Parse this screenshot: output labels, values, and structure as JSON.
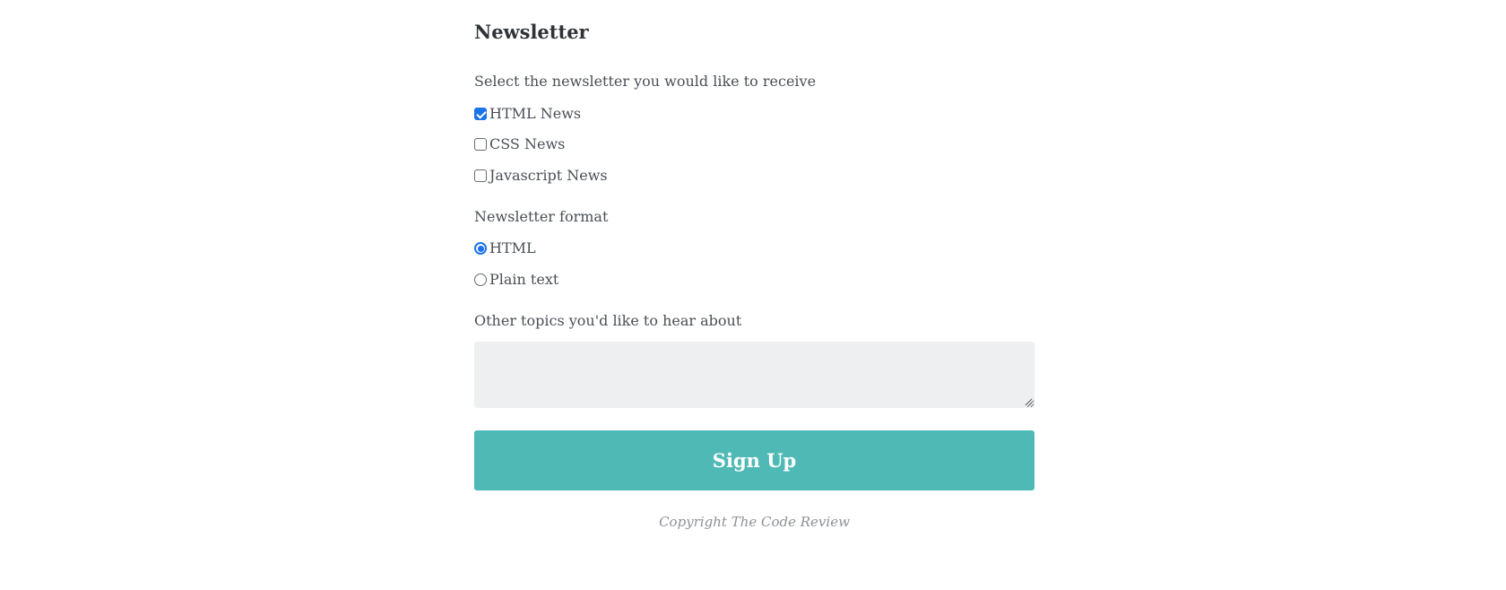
{
  "form": {
    "title": "Newsletter",
    "newsletter_prompt": "Select the newsletter you would like to receive",
    "newsletters": [
      {
        "label": "HTML News",
        "checked": true
      },
      {
        "label": "CSS News",
        "checked": false
      },
      {
        "label": "Javascript News",
        "checked": false
      }
    ],
    "format_prompt": "Newsletter format",
    "formats": [
      {
        "label": "HTML",
        "selected": true
      },
      {
        "label": "Plain text",
        "selected": false
      }
    ],
    "topics_prompt": "Other topics you'd like to hear about",
    "topics_value": "",
    "submit_label": "Sign Up"
  },
  "footer": {
    "copyright": "Copyright The Code Review"
  },
  "colors": {
    "accent": "#4fb9b5",
    "checkbox": "#1a73e8",
    "textarea_bg": "#eeeff0"
  }
}
